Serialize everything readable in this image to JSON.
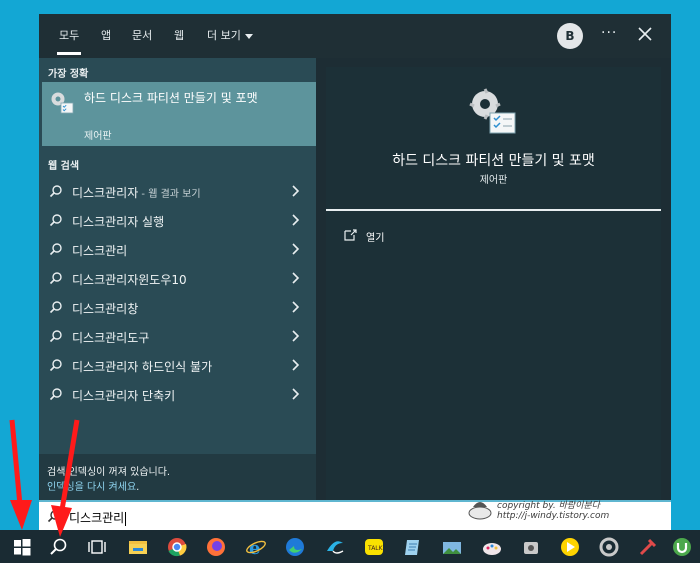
{
  "panel": {
    "tabs": [
      {
        "label": "모두",
        "active": true
      },
      {
        "label": "앱"
      },
      {
        "label": "문서"
      },
      {
        "label": "웹"
      },
      {
        "label": "더 보기"
      }
    ],
    "avatar": "B",
    "more": "···",
    "close_icon": "close-icon"
  },
  "left": {
    "best_label": "가장 정확",
    "best": {
      "title": "하드 디스크 파티션 만들기 및 포맷",
      "subtitle": "제어판"
    },
    "web_label": "웹 검색",
    "results": [
      {
        "text": "디스크관리자",
        "suffix": " - 웹 결과 보기"
      },
      {
        "text": "디스크관리자 실행"
      },
      {
        "text": "디스크관리"
      },
      {
        "text": "디스크관리자윈도우10"
      },
      {
        "text": "디스크관리창"
      },
      {
        "text": "디스크관리도구"
      },
      {
        "text": "디스크관리자 하드인식 불가"
      },
      {
        "text": "디스크관리자 단축키"
      }
    ],
    "notice": {
      "line1": "검색 인덱싱이 꺼져 있습니다.",
      "line2_link": "인덱싱을 다시 켜세요",
      "line2_end": "."
    }
  },
  "preview": {
    "title": "하드 디스크 파티션 만들기 및 포맷",
    "subtitle": "제어판",
    "open_label": "열기"
  },
  "search": {
    "value": "디스크관리"
  },
  "watermark": {
    "line1": "copyright by. 바람이분다",
    "line2": "http://j-windy.tistory.com"
  },
  "taskbar": {
    "icons": [
      "windows-start-icon",
      "search-icon",
      "task-view-icon",
      "file-explorer-icon",
      "chrome-icon",
      "firefox-icon",
      "ie-icon",
      "edge-icon",
      "app-icon",
      "kakaotalk-icon",
      "notepad-icon",
      "photo-icon",
      "paint-icon",
      "app2-icon",
      "media-icon",
      "settings-icon",
      "tool-icon",
      "lightroom-icon",
      "utorrent-icon"
    ]
  },
  "colors": {
    "panel": "#1d2d34",
    "left": "#2a4b55",
    "best": "#5d949c",
    "accent_link": "#8fd4ef",
    "taskbar": "#1a2b33",
    "arrow": "#ff1a1a"
  }
}
